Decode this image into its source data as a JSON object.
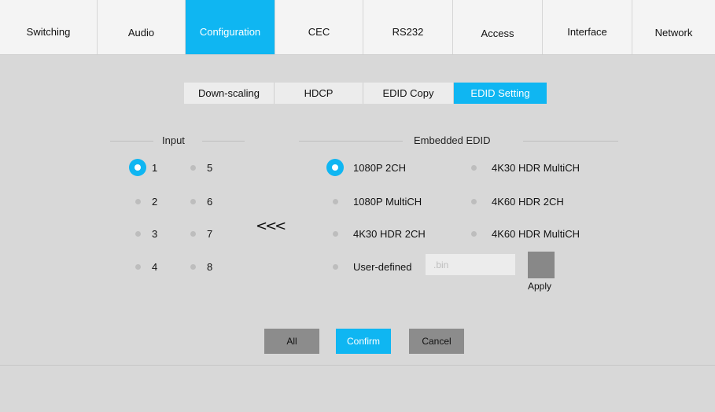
{
  "nav": {
    "tabs": [
      {
        "label": "Switching"
      },
      {
        "label": "Audio"
      },
      {
        "label": "Configuration",
        "active": true
      },
      {
        "label": "CEC"
      },
      {
        "label": "RS232"
      },
      {
        "label": "Access"
      },
      {
        "label": "Interface"
      },
      {
        "label": "Network"
      }
    ]
  },
  "subtabs": [
    {
      "label": "Down-scaling"
    },
    {
      "label": "HDCP"
    },
    {
      "label": "EDID Copy"
    },
    {
      "label": "EDID Setting",
      "active": true
    }
  ],
  "input_section": {
    "title": "Input",
    "options": [
      "1",
      "2",
      "3",
      "4",
      "5",
      "6",
      "7",
      "8"
    ],
    "selected": "1"
  },
  "edid_section": {
    "title": "Embedded EDID",
    "options": [
      "1080P 2CH",
      "1080P MultiCH",
      "4K30 HDR 2CH",
      "User-defined",
      "4K30 HDR MultiCH",
      "4K60 HDR 2CH",
      "4K60 HDR MultiCH"
    ],
    "selected": "1080P 2CH"
  },
  "arrow": "<<<",
  "file_input": {
    "placeholder": ".bin"
  },
  "apply_label": "Apply",
  "buttons": {
    "all": "All",
    "confirm": "Confirm",
    "cancel": "Cancel"
  },
  "colors": {
    "accent": "#0fb6f2",
    "button_gray": "#8c8c8c",
    "background": "#d8d8d8"
  }
}
